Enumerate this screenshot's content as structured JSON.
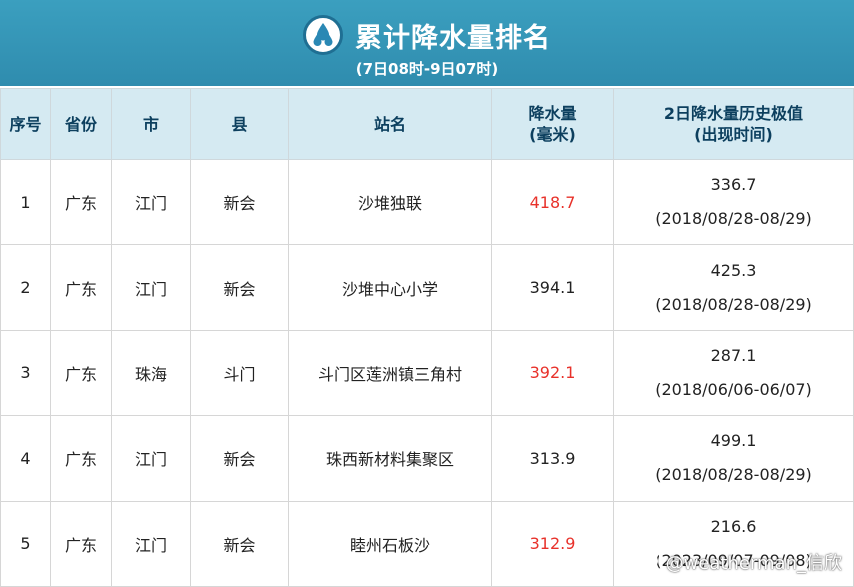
{
  "header": {
    "title": "累计降水量排名",
    "subtitle": "(7日08时-9日07时)",
    "icon": "raindrops-icon"
  },
  "columns": {
    "rank": "序号",
    "province": "省份",
    "city": "市",
    "county": "县",
    "station": "站名",
    "rain_line1": "降水量",
    "rain_line2": "(毫米)",
    "hist_line1": "2日降水量历史极值",
    "hist_line2": "(出现时间)"
  },
  "rows": [
    {
      "rank": "1",
      "province": "广东",
      "city": "江门",
      "county": "新会",
      "station": "沙堆独联",
      "rain": "418.7",
      "rain_highlight": true,
      "hist_value": "336.7",
      "hist_date": "(2018/08/28-08/29)"
    },
    {
      "rank": "2",
      "province": "广东",
      "city": "江门",
      "county": "新会",
      "station": "沙堆中心小学",
      "rain": "394.1",
      "rain_highlight": false,
      "hist_value": "425.3",
      "hist_date": "(2018/08/28-08/29)"
    },
    {
      "rank": "3",
      "province": "广东",
      "city": "珠海",
      "county": "斗门",
      "station": "斗门区莲洲镇三角村",
      "rain": "392.1",
      "rain_highlight": true,
      "hist_value": "287.1",
      "hist_date": "(2018/06/06-06/07)"
    },
    {
      "rank": "4",
      "province": "广东",
      "city": "江门",
      "county": "新会",
      "station": "珠西新材料集聚区",
      "rain": "313.9",
      "rain_highlight": false,
      "hist_value": "499.1",
      "hist_date": "(2018/08/28-08/29)"
    },
    {
      "rank": "5",
      "province": "广东",
      "city": "江门",
      "county": "新会",
      "station": "睦州石板沙",
      "rain": "312.9",
      "rain_highlight": true,
      "hist_value": "216.6",
      "hist_date": "(2023/09/07-09/08)"
    }
  ],
  "colors": {
    "banner": "#3b9fbf",
    "header_bg": "#d5eaf2",
    "highlight": "#e8312a"
  },
  "watermark": {
    "text": "@weatherman_信欣",
    "icon": "weibo-logo-icon"
  }
}
